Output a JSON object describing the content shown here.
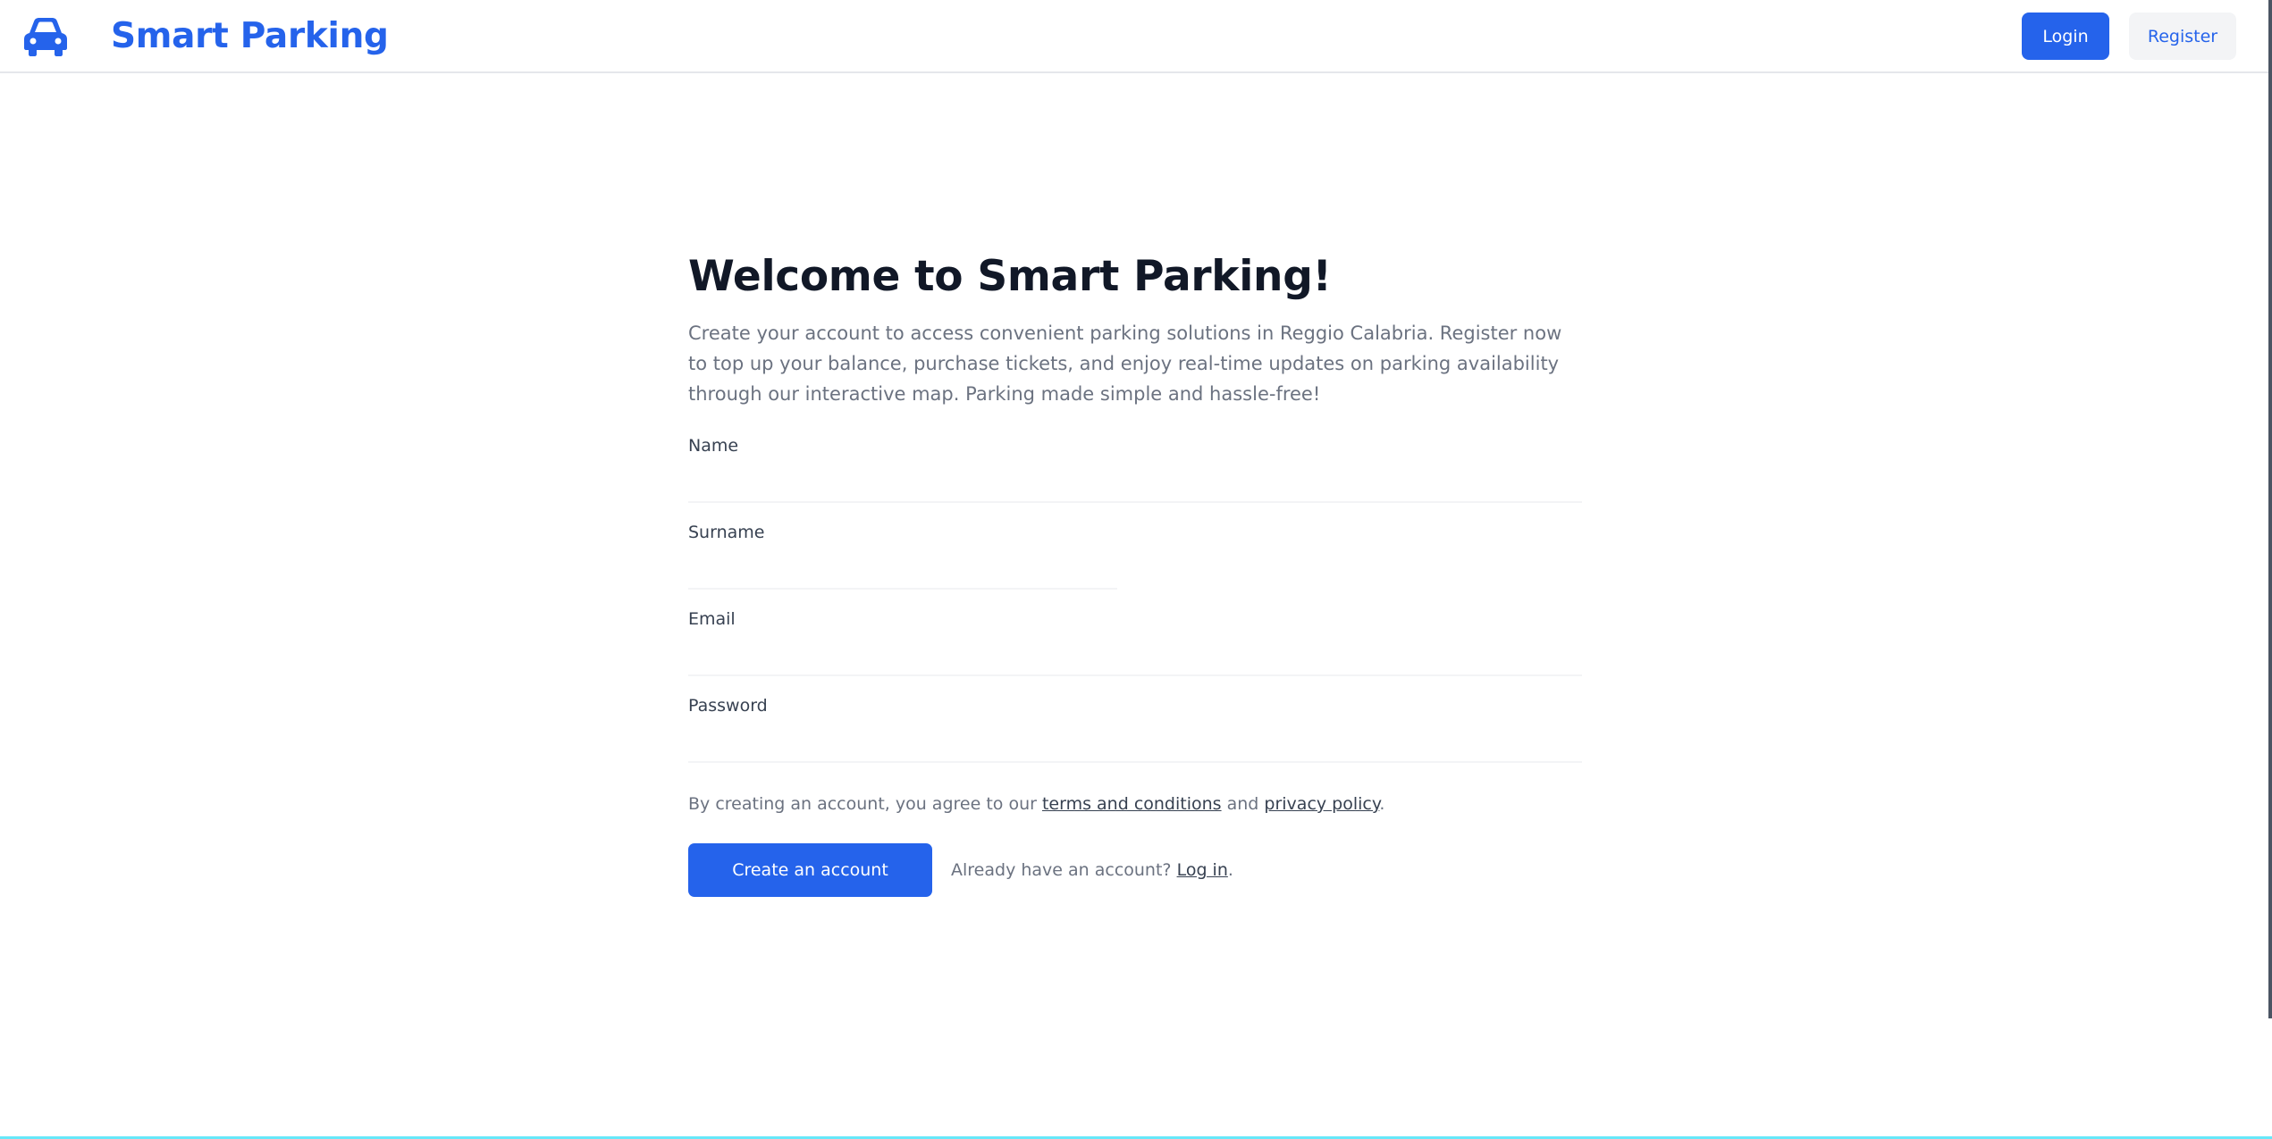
{
  "header": {
    "brand_icon": "car-icon",
    "brand_title": "Smart Parking",
    "login_label": "Login",
    "register_label": "Register"
  },
  "main": {
    "title": "Welcome to Smart Parking!",
    "intro": "Create your account to access convenient parking solutions in Reggio Calabria. Register now to top up your balance, purchase tickets, and enjoy real-time updates on parking availability through our interactive map. Parking made simple and hassle-free!",
    "form": {
      "name_label": "Name",
      "surname_label": "Surname",
      "email_label": "Email",
      "password_label": "Password",
      "name_value": "",
      "surname_value": "",
      "email_value": "",
      "password_value": ""
    },
    "terms": {
      "prefix": "By creating an account, you agree to our ",
      "terms_link": "terms and conditions",
      "middle": " and ",
      "privacy_link": "privacy policy",
      "suffix": "."
    },
    "create_button": "Create an account",
    "login_prompt": {
      "text": "Already have an account? ",
      "link": "Log in",
      "suffix": "."
    }
  },
  "colors": {
    "accent": "#2563eb",
    "heading": "#111827",
    "muted": "#6b7280",
    "secondary_button": "#f3f4f6"
  }
}
